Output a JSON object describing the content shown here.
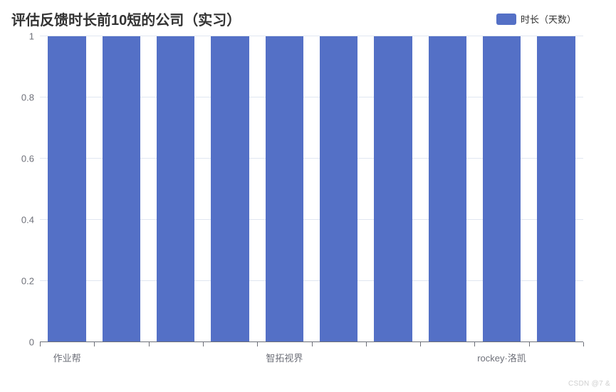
{
  "chart_data": {
    "type": "bar",
    "title": "评估反馈时长前10短的公司（实习）",
    "legend_label": "时长（天数）",
    "ylabel": "",
    "xlabel": "",
    "ylim": [
      0,
      1
    ],
    "y_ticks": [
      0,
      0.2,
      0.4,
      0.6,
      0.8,
      1
    ],
    "categories": [
      "作业帮",
      "",
      "",
      "",
      "智拓视界",
      "",
      "",
      "",
      "rockey·洛凯",
      ""
    ],
    "values": [
      1,
      1,
      1,
      1,
      1,
      1,
      1,
      1,
      1,
      1
    ],
    "bar_color": "#5470c6"
  },
  "watermark": "CSDN @7 &"
}
